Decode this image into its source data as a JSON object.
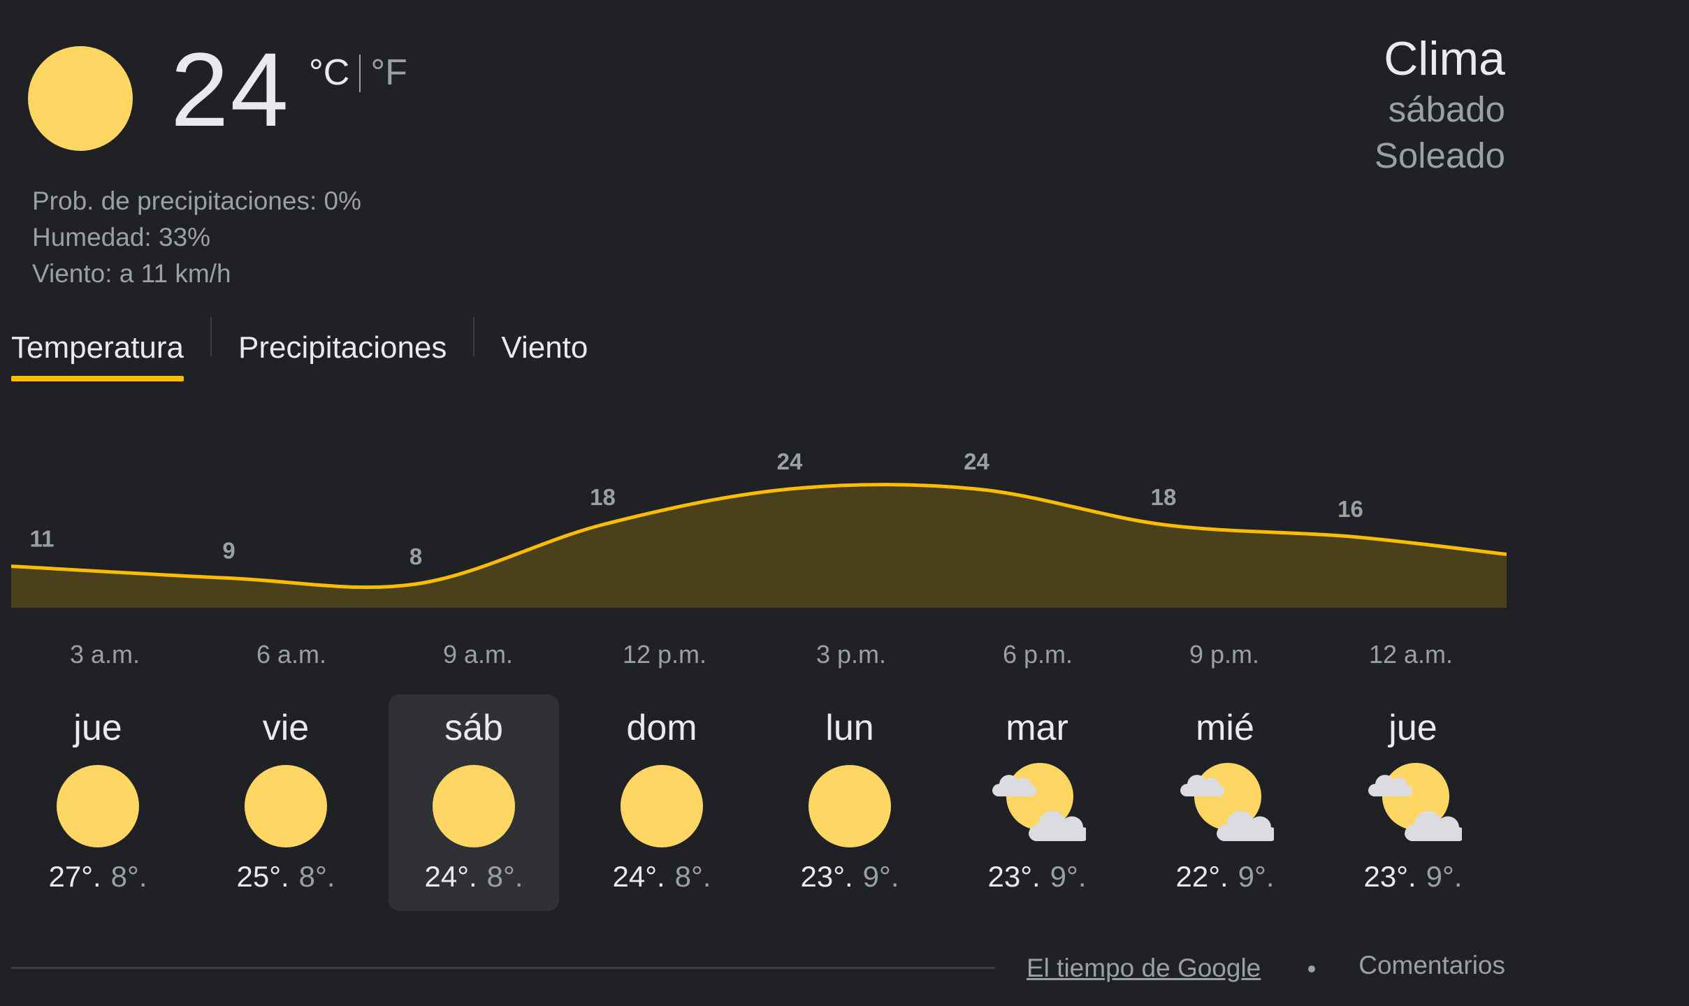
{
  "current": {
    "icon": "sun-icon",
    "temperature": "24",
    "unit_c": "°C",
    "unit_f": "°F",
    "precipitation": "Prob. de precipitaciones: 0%",
    "humidity": "Humedad: 33%",
    "wind": "Viento: a 11 km/h"
  },
  "header": {
    "title": "Clima",
    "day": "sábado",
    "condition": "Soleado"
  },
  "tabs": [
    {
      "label": "Temperatura",
      "active": true
    },
    {
      "label": "Precipitaciones",
      "active": false
    },
    {
      "label": "Viento",
      "active": false
    }
  ],
  "colors": {
    "background": "#202124",
    "accent": "#fbbc04",
    "sun": "#fdd663",
    "chart_fill": "#4a401b",
    "text_primary": "#e8eaed",
    "text_secondary": "#9aa0a6",
    "selected_day_bg": "#303134"
  },
  "chart_data": {
    "type": "area",
    "x": [
      "12 a.m.",
      "3 a.m.",
      "6 a.m.",
      "9 a.m.",
      "12 p.m.",
      "3 p.m.",
      "6 p.m.",
      "9 p.m.",
      "12 a.m."
    ],
    "values": [
      11,
      9,
      8,
      18,
      24,
      24,
      18,
      16,
      13
    ],
    "value_labels": [
      "11",
      "9",
      "8",
      "18",
      "24",
      "24",
      "18",
      "16"
    ],
    "hour_labels": [
      "3 a.m.",
      "6 a.m.",
      "9 a.m.",
      "12 p.m.",
      "3 p.m.",
      "6 p.m.",
      "9 p.m.",
      "12 a.m."
    ],
    "grid": false
  },
  "days": [
    {
      "name": "jue",
      "icon": "sun-icon",
      "high": "27°.",
      "low": "8°.",
      "selected": false
    },
    {
      "name": "vie",
      "icon": "sun-icon",
      "high": "25°.",
      "low": "8°.",
      "selected": false
    },
    {
      "name": "sáb",
      "icon": "sun-icon",
      "high": "24°.",
      "low": "8°.",
      "selected": true
    },
    {
      "name": "dom",
      "icon": "sun-icon",
      "high": "24°.",
      "low": "8°.",
      "selected": false
    },
    {
      "name": "lun",
      "icon": "sun-icon",
      "high": "23°.",
      "low": "9°.",
      "selected": false
    },
    {
      "name": "mar",
      "icon": "partly-cloudy-icon",
      "high": "23°.",
      "low": "9°.",
      "selected": false
    },
    {
      "name": "mié",
      "icon": "partly-cloudy-icon",
      "high": "22°.",
      "low": "9°.",
      "selected": false
    },
    {
      "name": "jue",
      "icon": "partly-cloudy-icon",
      "high": "23°.",
      "low": "9°.",
      "selected": false
    }
  ],
  "footer": {
    "source": "El tiempo de Google",
    "feedback": "Comentarios"
  }
}
